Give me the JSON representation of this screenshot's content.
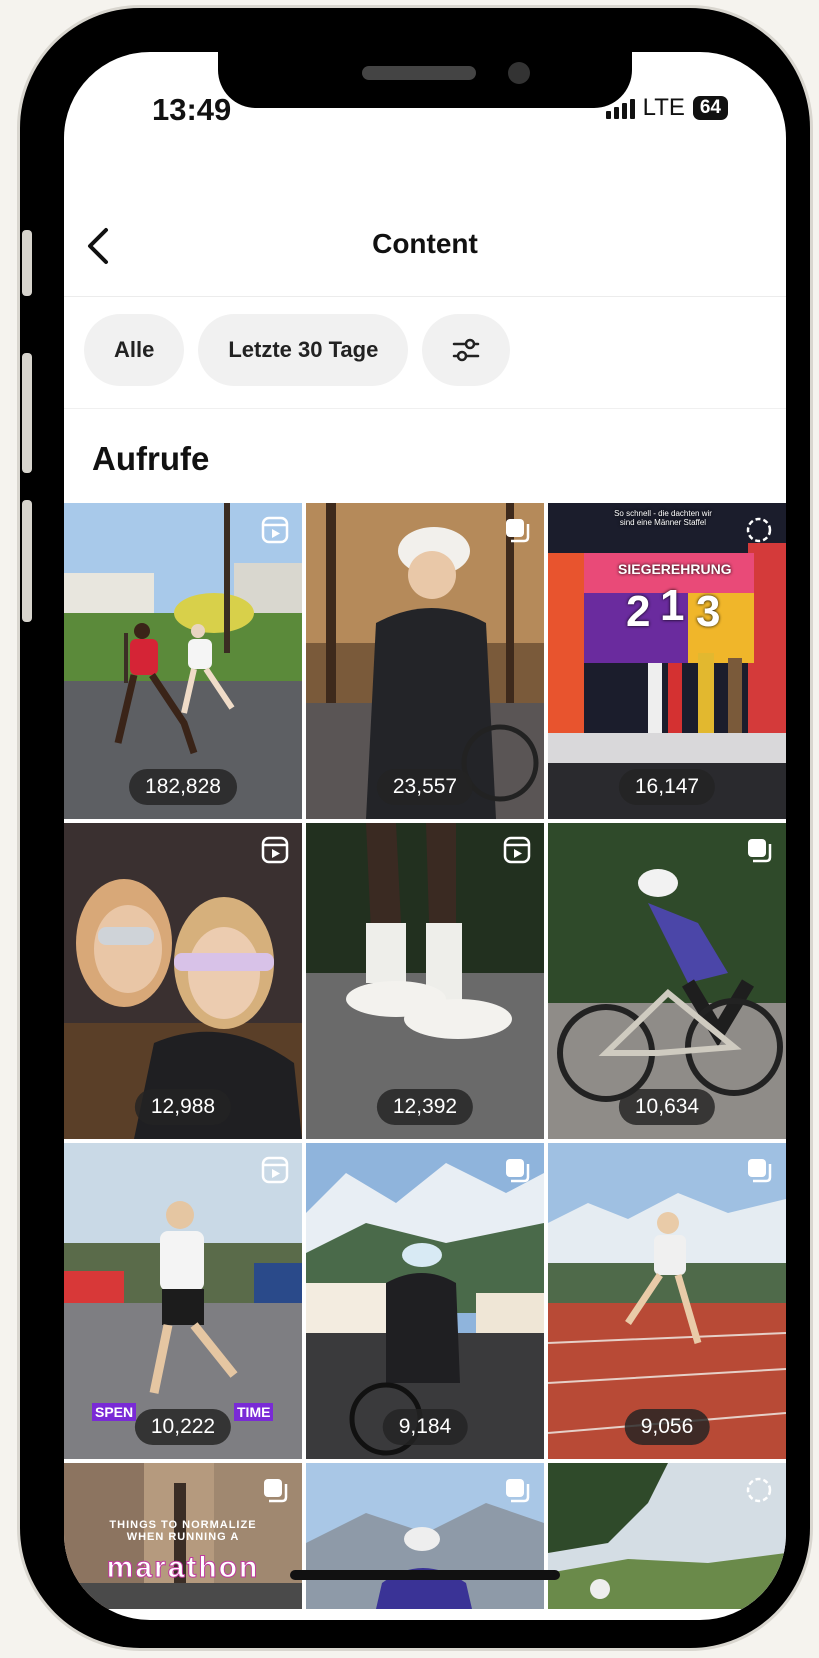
{
  "status_bar": {
    "time": "13:49",
    "network": "LTE",
    "battery": "64"
  },
  "header": {
    "title": "Content",
    "back_icon": "chevron-left-icon"
  },
  "filters": [
    {
      "label": "Alle"
    },
    {
      "label": "Letzte 30 Tage"
    },
    {
      "label": "",
      "icon": "sliders-icon"
    }
  ],
  "section": {
    "title": "Aufrufe"
  },
  "posts": [
    {
      "views": "182,828",
      "type": "reel",
      "type_icon": "reel-icon"
    },
    {
      "views": "23,557",
      "type": "post",
      "type_icon": "carousel-icon"
    },
    {
      "views": "16,147",
      "type": "loading",
      "type_icon": "loading-icon",
      "overlay_text": "So schnell - die dachten wir\nsind eine Männer Staffel",
      "banner_text": "SIEGEREHRUNG",
      "podium": [
        "2",
        "1",
        "3"
      ]
    },
    {
      "views": "12,988",
      "type": "reel",
      "type_icon": "reel-icon"
    },
    {
      "views": "12,392",
      "type": "reel",
      "type_icon": "reel-icon"
    },
    {
      "views": "10,634",
      "type": "post",
      "type_icon": "carousel-icon"
    },
    {
      "views": "10,222",
      "type": "reel",
      "type_icon": "reel-icon",
      "caption_left": "SPEN",
      "caption_right": "TIME"
    },
    {
      "views": "9,184",
      "type": "post",
      "type_icon": "carousel-icon"
    },
    {
      "views": "9,056",
      "type": "post",
      "type_icon": "carousel-icon"
    },
    {
      "views": "",
      "type": "post",
      "type_icon": "carousel-icon",
      "title_text": "THINGS TO NORMALIZE\nWHEN RUNNING A",
      "big_text": "marathon"
    },
    {
      "views": "",
      "type": "post",
      "type_icon": "carousel-icon"
    },
    {
      "views": "",
      "type": "loading",
      "type_icon": "loading-icon"
    }
  ],
  "colors": {
    "background": "#ffffff",
    "chip_bg": "#f1f1f1",
    "badge_bg": "#232323",
    "text": "#111111"
  }
}
